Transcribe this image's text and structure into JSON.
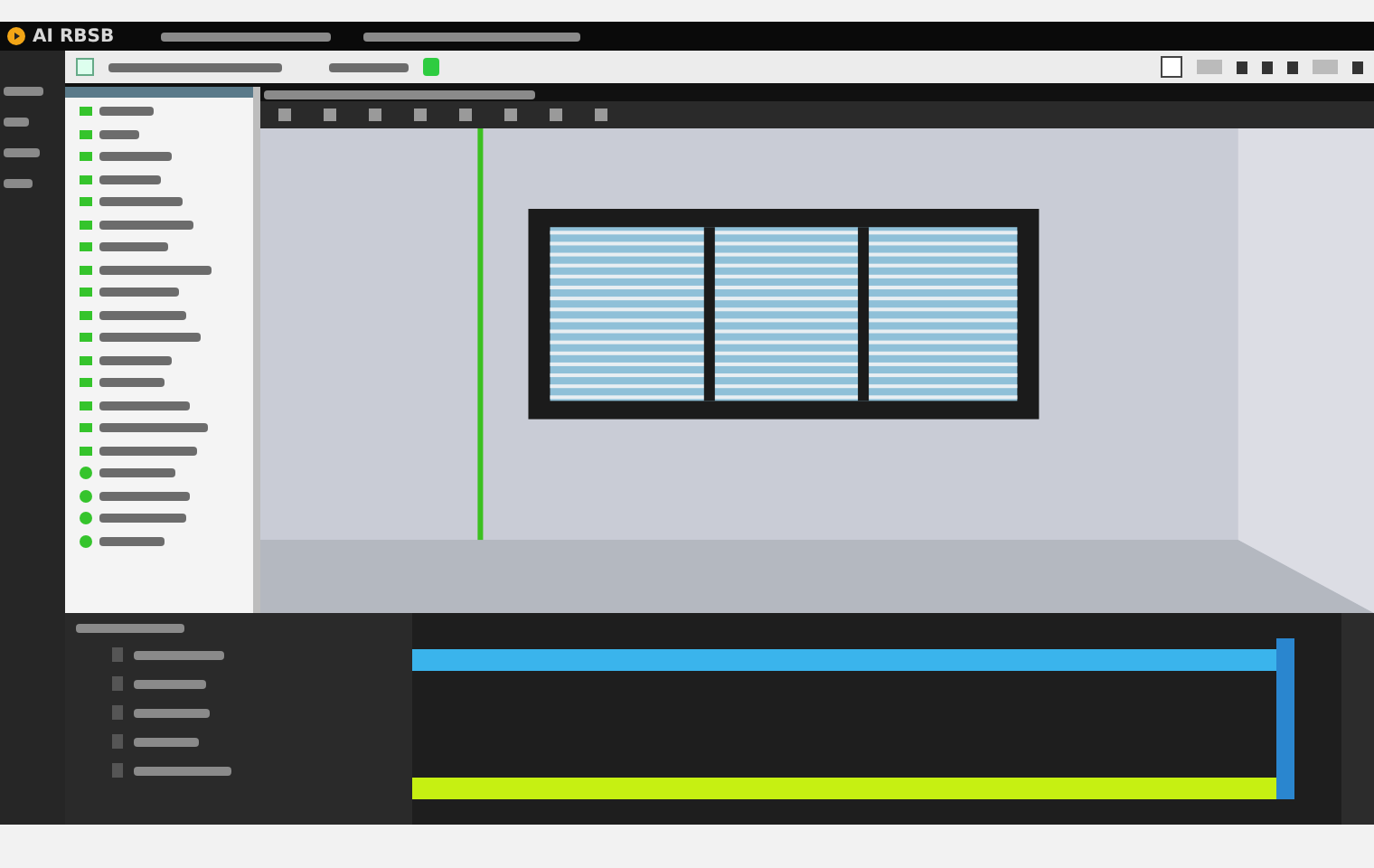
{
  "app": {
    "name": "AI RBSB"
  },
  "asset_list": {
    "items": [
      {
        "kind": "square"
      },
      {
        "kind": "square"
      },
      {
        "kind": "square"
      },
      {
        "kind": "square"
      },
      {
        "kind": "square"
      },
      {
        "kind": "square"
      },
      {
        "kind": "square"
      },
      {
        "kind": "square"
      },
      {
        "kind": "square"
      },
      {
        "kind": "square"
      },
      {
        "kind": "square"
      },
      {
        "kind": "square"
      },
      {
        "kind": "square"
      },
      {
        "kind": "square"
      },
      {
        "kind": "square"
      },
      {
        "kind": "square"
      },
      {
        "kind": "circle"
      },
      {
        "kind": "circle"
      },
      {
        "kind": "circle"
      },
      {
        "kind": "circle"
      }
    ]
  },
  "timeline": {
    "tracks": [
      {
        "color": "#3ab4ec",
        "level": 0.93
      },
      {
        "color": "#c6f012",
        "level": 0.93
      }
    ]
  }
}
